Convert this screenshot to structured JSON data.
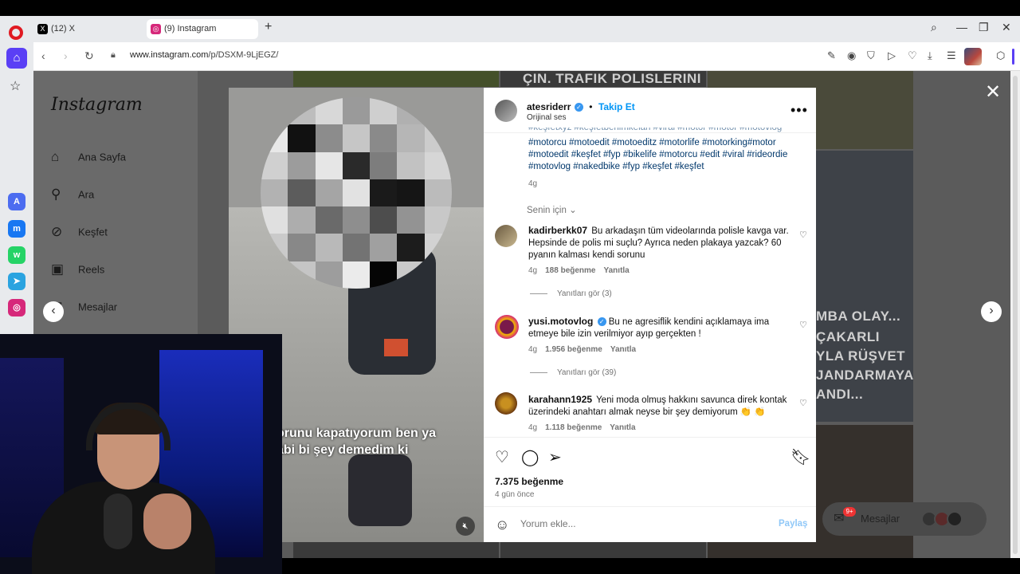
{
  "browser": {
    "tabs": [
      {
        "label": "(12) X",
        "icon": "x-logo-icon",
        "active": false
      },
      {
        "label": "(9) Instagram",
        "icon": "instagram-logo-icon",
        "active": true
      }
    ],
    "url_host": "www.instagram.com",
    "url_path": "/p/DSXM-9LjEGZ/"
  },
  "instagram": {
    "logo": "Instagram",
    "nav": [
      {
        "label": "Ana Sayfa",
        "icon": "home-icon"
      },
      {
        "label": "Ara",
        "icon": "search-icon"
      },
      {
        "label": "Keşfet",
        "icon": "compass-icon"
      },
      {
        "label": "Reels",
        "icon": "reels-icon"
      },
      {
        "label": "Mesajlar",
        "icon": "messenger-icon",
        "badge": "9+"
      }
    ],
    "tiles": {
      "t1": "ÇIN. TRAFIK POLISLERINI",
      "t2": "MBA OLAY...",
      "t3": "ÇAKARLI",
      "t4": "YLA RÜŞVET",
      "t5": "JANDARMAYA",
      "t6": "ANDI..."
    },
    "floating_messages": {
      "label": "Mesajlar",
      "badge": "9+"
    }
  },
  "post": {
    "media_text_line1": "orunu kapatıyorum ben ya",
    "media_text_line2": "abi bi şey demedim ki",
    "username": "atesriderr",
    "separator": "•",
    "follow_label": "Takip Et",
    "audio": "Orijinal ses",
    "caption_partial_line": "#keşfetxyz #keşfetbenimkelan #viral #motor #motor #motovlog",
    "caption_lines": [
      "#motorcu #motoedit #motoeditz #motorlife #motorking#motor",
      "#motoedit #keşfet #fyp #bikelife #motorcu #edit #viral #rideordie",
      "#motovlog #nakedbike #fyp #keşfet #keşfet"
    ],
    "caption_time": "4g",
    "for_you": "Senin için",
    "comments": [
      {
        "user": "kadirberkk07",
        "verified": false,
        "text": "Bu arkadaşın tüm videolarında polisle kavga var. Hepsinde de polis mi suçlu? Ayrıca neden plakaya yazcak? 60 pyanın kalması kendi sorunu",
        "time": "4g",
        "likes": "188 beğenme",
        "reply": "Yanıtla",
        "view_replies": "Yanıtları gör (3)"
      },
      {
        "user": "yusi.motovlog",
        "verified": true,
        "text": "Bu ne agresiflik kendini açıklamaya ima etmeye bile izin verilmiyor ayıp gerçekten !",
        "time": "4g",
        "likes": "1.956 beğenme",
        "reply": "Yanıtla",
        "view_replies": "Yanıtları gör (39)"
      },
      {
        "user": "karahann1925",
        "verified": false,
        "text": "Yeni moda olmuş hakkını savunca direk kontak üzerindeki anahtarı almak neyse bir şey demiyorum 👏 👏",
        "time": "4g",
        "likes": "1.118 beğenme",
        "reply": "Yanıtla"
      }
    ],
    "like_count": "7.375 beğenme",
    "posted_ago": "4 gün önce",
    "comment_placeholder": "Yorum ekle...",
    "share_label": "Paylaş"
  },
  "colors": {
    "ig_blue": "#0095f6",
    "opera_red": "#e01a22",
    "opera_purple": "#5a3ff5"
  }
}
